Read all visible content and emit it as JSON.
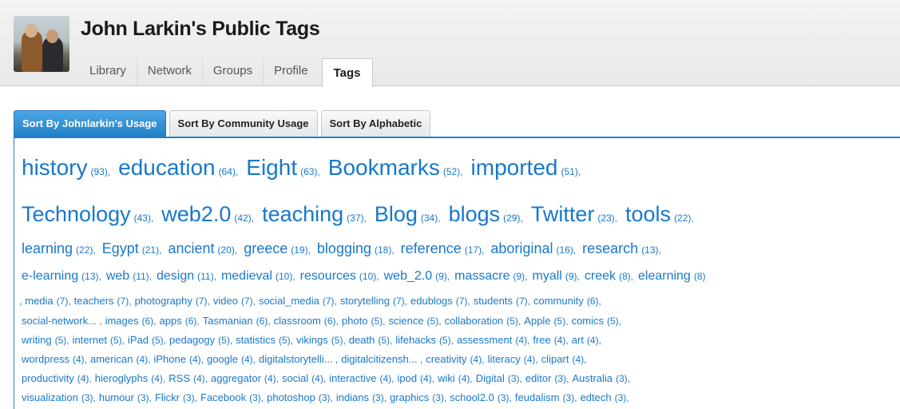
{
  "header": {
    "title": "John Larkin's Public Tags",
    "nav_tabs": [
      "Library",
      "Network",
      "Groups",
      "Profile",
      "Tags"
    ],
    "active_tab": "Tags"
  },
  "sort_tabs": [
    "Sort By Johnlarkin's Usage",
    "Sort By Community Usage",
    "Sort By Alphabetic"
  ],
  "active_sort": "Sort By Johnlarkin's Usage",
  "colors": {
    "tag_link": "#1878cc",
    "active_sort_tab": "#2580c8"
  },
  "tag_rows": [
    [
      {
        "name": "history",
        "count": "(93)"
      },
      {
        "name": "education",
        "count": "(64)"
      },
      {
        "name": "Eight",
        "count": "(63)"
      },
      {
        "name": "Bookmarks",
        "count": "(52)"
      },
      {
        "name": "imported",
        "count": "(51)"
      }
    ],
    [
      {
        "name": "Technology",
        "count": "(43)"
      },
      {
        "name": "web2.0",
        "count": "(42)"
      },
      {
        "name": "teaching",
        "count": "(37)"
      },
      {
        "name": "Blog",
        "count": "(34)"
      },
      {
        "name": "blogs",
        "count": "(29)"
      },
      {
        "name": "Twitter",
        "count": "(23)"
      },
      {
        "name": "tools",
        "count": "(22)"
      }
    ],
    [
      {
        "name": "learning",
        "count": "(22)"
      },
      {
        "name": "Egypt",
        "count": "(21)"
      },
      {
        "name": "ancient",
        "count": "(20)"
      },
      {
        "name": "greece",
        "count": "(19)"
      },
      {
        "name": "blogging",
        "count": "(18)"
      },
      {
        "name": "reference",
        "count": "(17)"
      },
      {
        "name": "aboriginal",
        "count": "(16)"
      },
      {
        "name": "research",
        "count": "(13)"
      }
    ],
    [
      {
        "name": "e-learning",
        "count": "(13)"
      },
      {
        "name": "web",
        "count": "(11)"
      },
      {
        "name": "design",
        "count": "(11)"
      },
      {
        "name": "medieval",
        "count": "(10)"
      },
      {
        "name": "resources",
        "count": "(10)"
      },
      {
        "name": "web_2.0",
        "count": "(9)"
      },
      {
        "name": "massacre",
        "count": "(9)"
      },
      {
        "name": "myall",
        "count": "(9)"
      },
      {
        "name": "creek",
        "count": "(8)"
      },
      {
        "name": "elearning",
        "count": "(8)"
      }
    ],
    [
      {
        "name": "media",
        "count": "(7)"
      },
      {
        "name": "teachers",
        "count": "(7)"
      },
      {
        "name": "photography",
        "count": "(7)"
      },
      {
        "name": "video",
        "count": "(7)"
      },
      {
        "name": "social_media",
        "count": "(7)"
      },
      {
        "name": "storytelling",
        "count": "(7)"
      },
      {
        "name": "edublogs",
        "count": "(7)"
      },
      {
        "name": "students",
        "count": "(7)"
      },
      {
        "name": "community",
        "count": "(6)"
      }
    ],
    [
      {
        "name": "social-network...",
        "count": ""
      },
      {
        "name": "images",
        "count": "(6)"
      },
      {
        "name": "apps",
        "count": "(6)"
      },
      {
        "name": "Tasmanian",
        "count": "(6)"
      },
      {
        "name": "classroom",
        "count": "(6)"
      },
      {
        "name": "photo",
        "count": "(5)"
      },
      {
        "name": "science",
        "count": "(5)"
      },
      {
        "name": "collaboration",
        "count": "(5)"
      },
      {
        "name": "Apple",
        "count": "(5)"
      },
      {
        "name": "comics",
        "count": "(5)"
      }
    ],
    [
      {
        "name": "writing",
        "count": "(5)"
      },
      {
        "name": "internet",
        "count": "(5)"
      },
      {
        "name": "iPad",
        "count": "(5)"
      },
      {
        "name": "pedagogy",
        "count": "(5)"
      },
      {
        "name": "statistics",
        "count": "(5)"
      },
      {
        "name": "vikings",
        "count": "(5)"
      },
      {
        "name": "death",
        "count": "(5)"
      },
      {
        "name": "lifehacks",
        "count": "(5)"
      },
      {
        "name": "assessment",
        "count": "(4)"
      },
      {
        "name": "free",
        "count": "(4)"
      },
      {
        "name": "art",
        "count": "(4)"
      }
    ],
    [
      {
        "name": "wordpress",
        "count": "(4)"
      },
      {
        "name": "american",
        "count": "(4)"
      },
      {
        "name": "iPhone",
        "count": "(4)"
      },
      {
        "name": "google",
        "count": "(4)"
      },
      {
        "name": "digitalstorytelli...",
        "count": ""
      },
      {
        "name": "digitalcitizensh...",
        "count": ""
      },
      {
        "name": "creativity",
        "count": "(4)"
      },
      {
        "name": "literacy",
        "count": "(4)"
      },
      {
        "name": "clipart",
        "count": "(4)"
      }
    ],
    [
      {
        "name": "productivity",
        "count": "(4)"
      },
      {
        "name": "hieroglyphs",
        "count": "(4)"
      },
      {
        "name": "RSS",
        "count": "(4)"
      },
      {
        "name": "aggregator",
        "count": "(4)"
      },
      {
        "name": "social",
        "count": "(4)"
      },
      {
        "name": "interactive",
        "count": "(4)"
      },
      {
        "name": "ipod",
        "count": "(4)"
      },
      {
        "name": "wiki",
        "count": "(4)"
      },
      {
        "name": "Digital",
        "count": "(3)"
      },
      {
        "name": "editor",
        "count": "(3)"
      },
      {
        "name": "Australia",
        "count": "(3)"
      }
    ],
    [
      {
        "name": "visualization",
        "count": "(3)"
      },
      {
        "name": "humour",
        "count": "(3)"
      },
      {
        "name": "Flickr",
        "count": "(3)"
      },
      {
        "name": "Facebook",
        "count": "(3)"
      },
      {
        "name": "photoshop",
        "count": "(3)"
      },
      {
        "name": "indians",
        "count": "(3)"
      },
      {
        "name": "graphics",
        "count": "(3)"
      },
      {
        "name": "school2.0",
        "count": "(3)"
      },
      {
        "name": "feudalism",
        "count": "(3)"
      },
      {
        "name": "edtech",
        "count": "(3)"
      }
    ]
  ]
}
